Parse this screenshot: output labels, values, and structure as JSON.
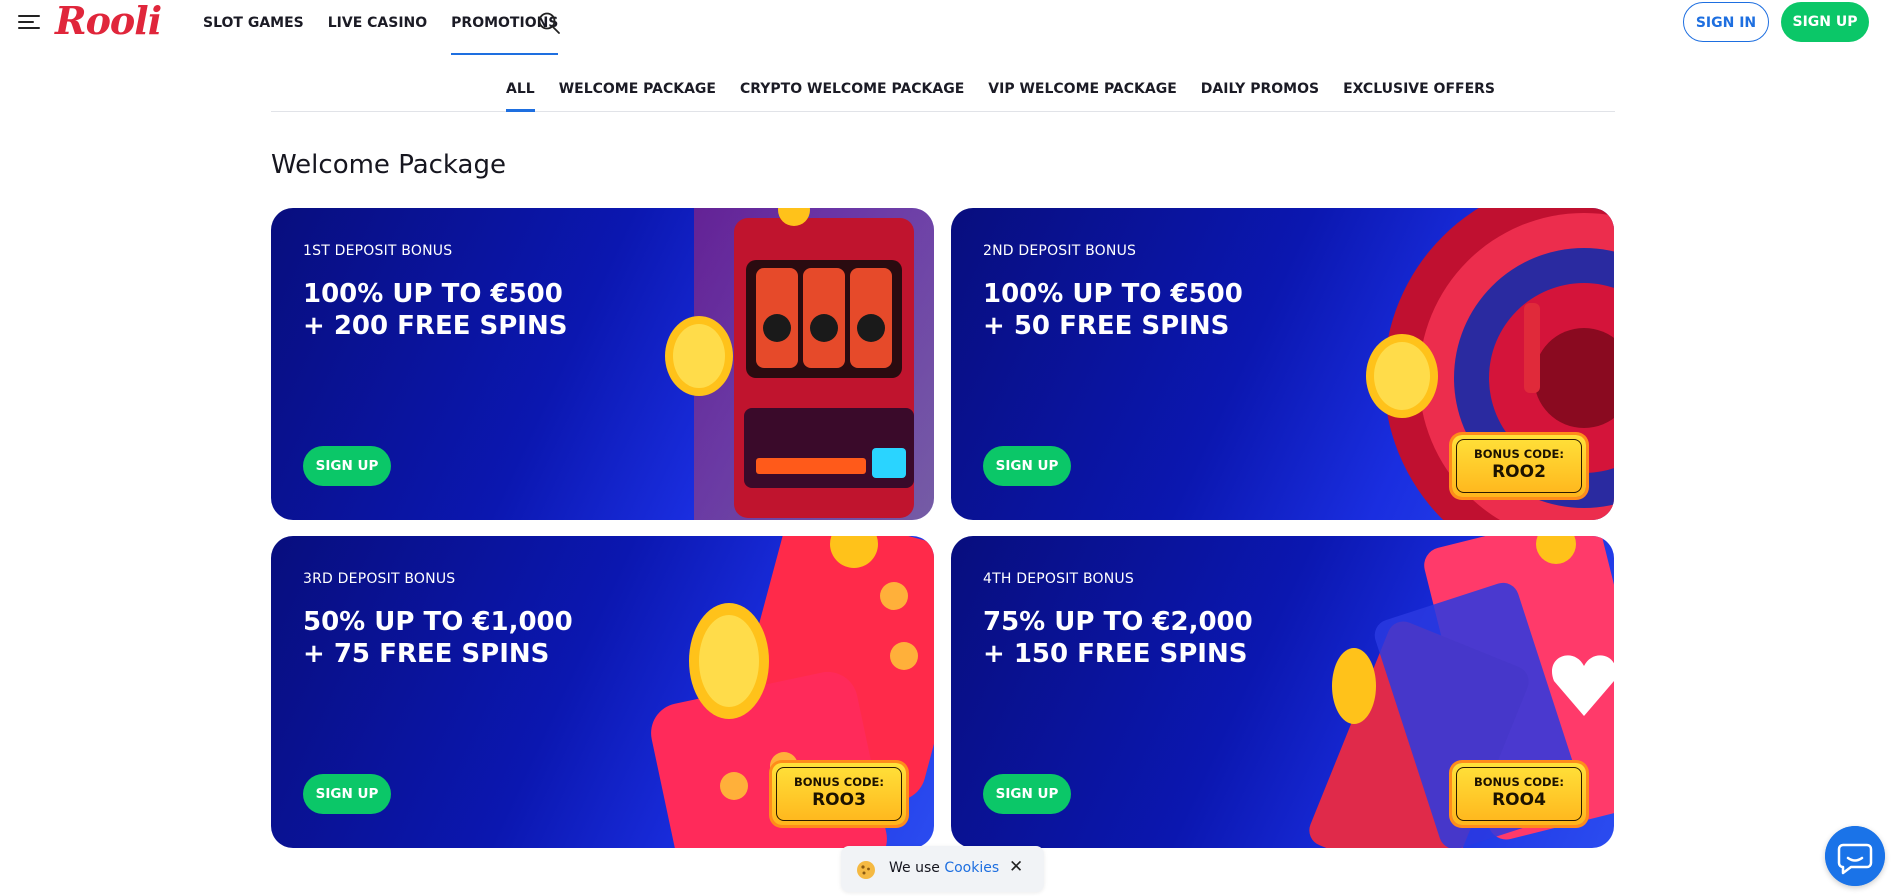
{
  "header": {
    "logo_text": "Rooli",
    "nav": [
      "SLOT GAMES",
      "LIVE CASINO",
      "PROMOTIONS"
    ],
    "active_nav": "PROMOTIONS",
    "sign_in": "SIGN IN",
    "sign_up": "SIGN UP"
  },
  "tabs": [
    "ALL",
    "WELCOME PACKAGE",
    "CRYPTO WELCOME PACKAGE",
    "VIP WELCOME PACKAGE",
    "DAILY PROMOS",
    "EXCLUSIVE OFFERS"
  ],
  "active_tab": "ALL",
  "section": {
    "title": "Welcome Package"
  },
  "cards": [
    {
      "eyebrow": "1ST DEPOSIT BONUS",
      "line1": "100% UP TO €500",
      "line2": "+ 200 FREE SPINS",
      "button": "SIGN UP"
    },
    {
      "eyebrow": "2ND DEPOSIT BONUS",
      "line1": "100% UP TO €500",
      "line2": "+ 50 FREE SPINS",
      "button": "SIGN UP",
      "badge_label": "BONUS CODE:",
      "badge_code": "ROO2"
    },
    {
      "eyebrow": "3RD DEPOSIT BONUS",
      "line1": "50% UP TO €1,000",
      "line2": "+ 75 FREE SPINS",
      "button": "SIGN UP",
      "badge_label": "BONUS CODE:",
      "badge_code": "ROO3"
    },
    {
      "eyebrow": "4TH DEPOSIT BONUS",
      "line1": "75% UP TO €2,000",
      "line2": "+ 150 FREE SPINS",
      "button": "SIGN UP",
      "badge_label": "BONUS CODE:",
      "badge_code": "ROO4"
    }
  ],
  "cookie": {
    "text": "We use",
    "link": "Cookies",
    "close": "✕"
  },
  "colors": {
    "accent_blue": "#1e6fe0",
    "brand_red": "#e0263b",
    "cta_green": "#0bc768",
    "card_blue": "#0b17b0"
  }
}
